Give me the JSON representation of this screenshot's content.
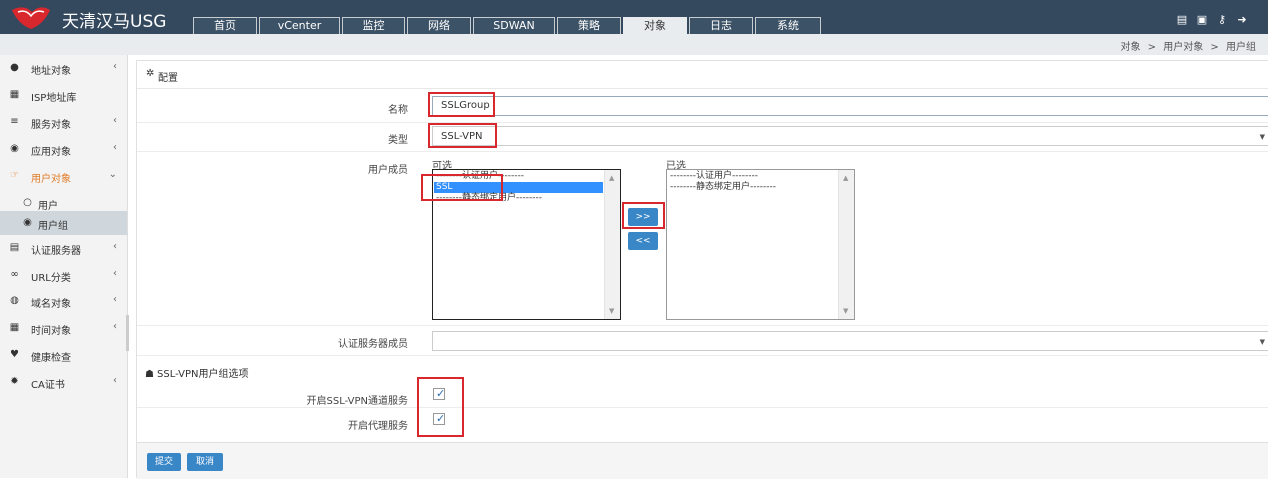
{
  "app": {
    "title": "天清汉马USG"
  },
  "top_tabs": [
    {
      "label": "首页"
    },
    {
      "label": "vCenter"
    },
    {
      "label": "监控"
    },
    {
      "label": "网络"
    },
    {
      "label": "SDWAN"
    },
    {
      "label": "策略"
    },
    {
      "label": "对象",
      "active": true
    },
    {
      "label": "日志"
    },
    {
      "label": "系统"
    }
  ],
  "toolbar_icons": [
    "book-icon",
    "save-icon",
    "key-icon",
    "logout-icon"
  ],
  "breadcrumb": {
    "level1": "对象",
    "sep": ">",
    "level2": "用户对象",
    "level3": "用户组"
  },
  "sidebar": {
    "items": [
      {
        "label": "地址对象",
        "icon": "map-marker-icon",
        "chevron": "‹"
      },
      {
        "label": "ISP地址库",
        "icon": "map-icon"
      },
      {
        "label": "服务对象",
        "icon": "list-icon",
        "chevron": "‹"
      },
      {
        "label": "应用对象",
        "icon": "gamepad-icon",
        "chevron": "‹"
      },
      {
        "label": "用户对象",
        "icon": "hand-icon",
        "chevron": "⌄",
        "open": true
      },
      {
        "label": "用户",
        "icon": "circle-icon",
        "sub": true
      },
      {
        "label": "用户组",
        "icon": "dot-circle-icon",
        "sub": true,
        "active": true
      },
      {
        "label": "认证服务器",
        "icon": "server-icon",
        "chevron": "‹"
      },
      {
        "label": "URL分类",
        "icon": "link-icon",
        "chevron": "‹"
      },
      {
        "label": "域名对象",
        "icon": "globe-icon",
        "chevron": "‹"
      },
      {
        "label": "时间对象",
        "icon": "calendar-icon",
        "chevron": "‹"
      },
      {
        "label": "健康检查",
        "icon": "heartbeat-icon"
      },
      {
        "label": "CA证书",
        "icon": "certificate-icon",
        "chevron": "‹"
      }
    ]
  },
  "panel": {
    "title": "配置"
  },
  "form": {
    "name_label": "名称",
    "name_value": "SSLGroup",
    "type_label": "类型",
    "type_value": "SSL-VPN",
    "members_label": "用户成员",
    "available_caption": "可选",
    "selected_caption": "已选",
    "available_options": [
      "--------认证用户--------",
      "SSL",
      "--------静态绑定用户--------"
    ],
    "selected_options": [
      "--------认证用户--------",
      "--------静态绑定用户--------"
    ],
    "add_button": ">>",
    "remove_button": "<<",
    "auth_server_label": "认证服务器成员",
    "auth_server_value": ""
  },
  "sslvpn_section": {
    "title": "SSL-VPN用户组选项",
    "tunnel_label": "开启SSL-VPN通道服务",
    "tunnel_checked": true,
    "proxy_label": "开启代理服务",
    "proxy_checked": true
  },
  "actions": {
    "submit": "提交",
    "cancel": "取消"
  },
  "colors": {
    "topbar": "#34495e",
    "accent_orange": "#e07b26",
    "primary_button": "#3a87c8",
    "highlight_red": "#d9272e",
    "selection_blue": "#3390ff"
  }
}
